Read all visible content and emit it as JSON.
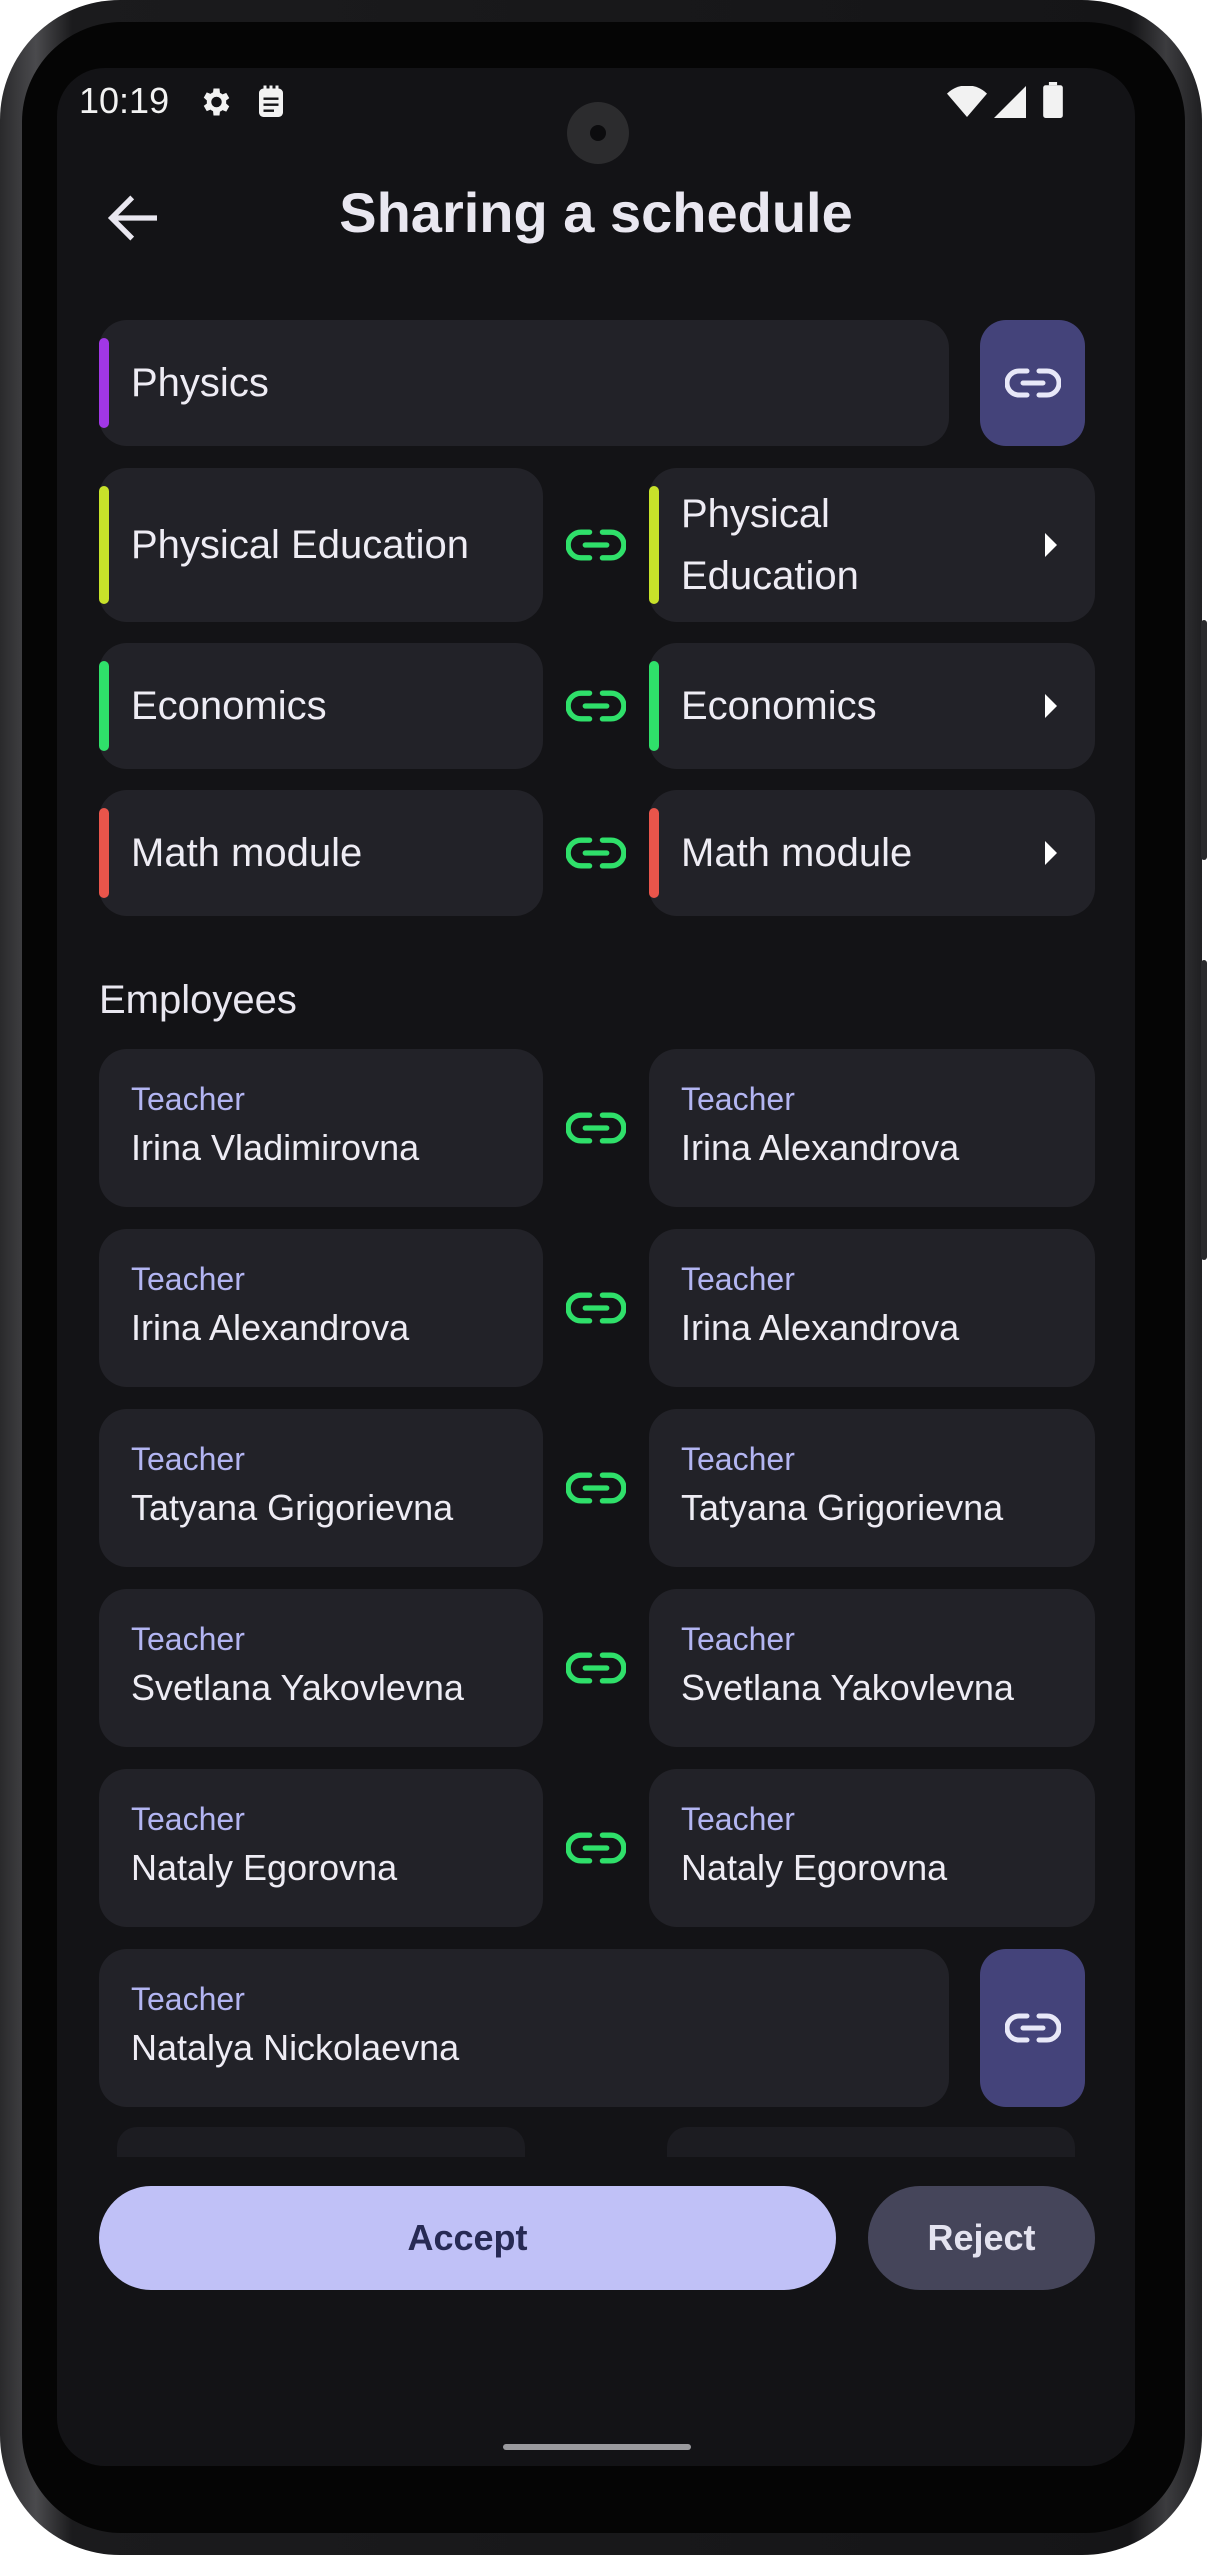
{
  "status_bar": {
    "time": "10:19"
  },
  "header": {
    "title": "Sharing a schedule"
  },
  "colors": {
    "physics": "#a137e6",
    "physical_education": "#c8e22a",
    "economics": "#2fe06a",
    "math_module": "#e9554b",
    "link_green": "#2fe06a",
    "accent": "#c0c1f7"
  },
  "subjects": {
    "unlinked": {
      "label": "Physics"
    },
    "pairs": [
      {
        "left": "Physical Education",
        "right": "Physical Education"
      },
      {
        "left": "Economics",
        "right": "Economics"
      },
      {
        "left": "Math module",
        "right": "Math module"
      }
    ]
  },
  "employees": {
    "title": "Employees",
    "pairs": [
      {
        "left_role": "Teacher",
        "left_name": "Irina Vladimirovna",
        "right_role": "Teacher",
        "right_name": "Irina Alexandrova"
      },
      {
        "left_role": "Teacher",
        "left_name": "Irina Alexandrova",
        "right_role": "Teacher",
        "right_name": "Irina Alexandrova"
      },
      {
        "left_role": "Teacher",
        "left_name": "Tatyana Grigorievna",
        "right_role": "Teacher",
        "right_name": "Tatyana Grigorievna"
      },
      {
        "left_role": "Teacher",
        "left_name": "Svetlana Yakovlevna",
        "right_role": "Teacher",
        "right_name": "Svetlana Yakovlevna"
      },
      {
        "left_role": "Teacher",
        "left_name": "Nataly Egorovna",
        "right_role": "Teacher",
        "right_name": "Nataly Egorovna"
      }
    ],
    "unlinked": {
      "role": "Teacher",
      "name": "Natalya Nickolaevna"
    }
  },
  "actions": {
    "accept_label": "Accept",
    "reject_label": "Reject"
  }
}
